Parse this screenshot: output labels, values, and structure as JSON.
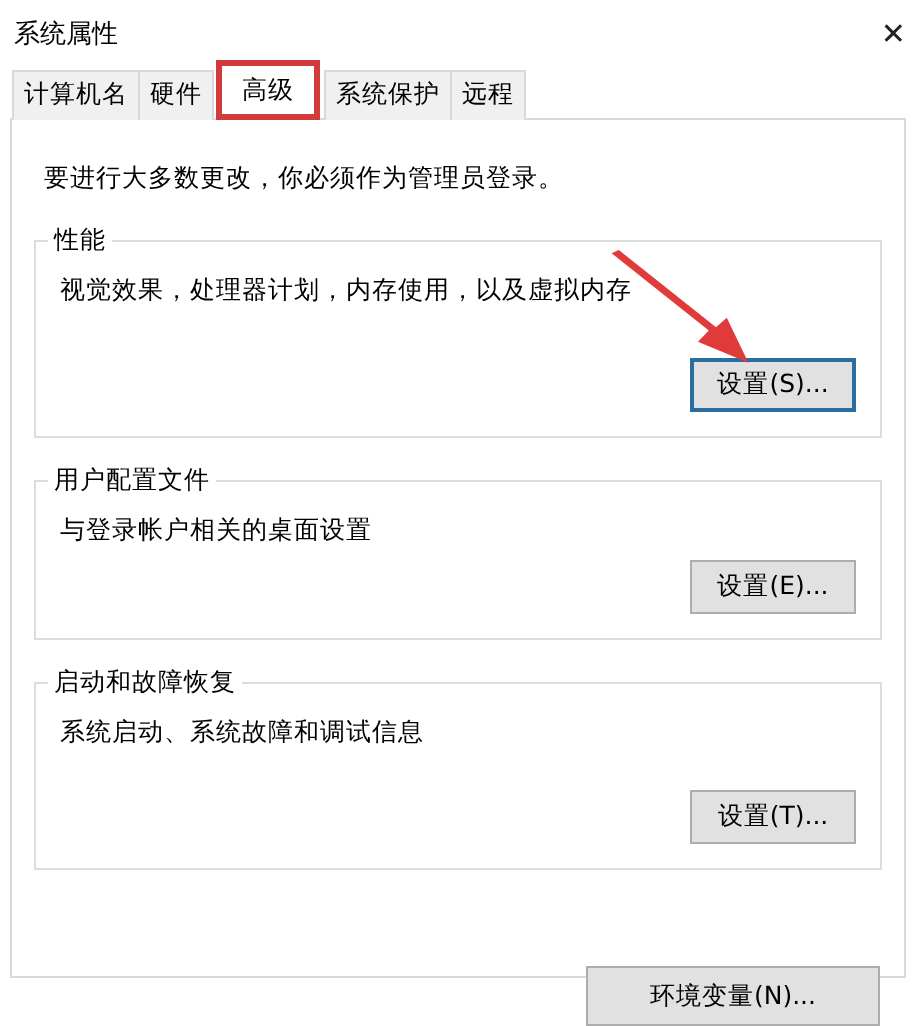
{
  "window": {
    "title": "系统属性",
    "close": "✕"
  },
  "tabs": [
    {
      "label": "计算机名",
      "selected": false,
      "highlighted": false
    },
    {
      "label": "硬件",
      "selected": false,
      "highlighted": false
    },
    {
      "label": "高级",
      "selected": true,
      "highlighted": true
    },
    {
      "label": "系统保护",
      "selected": false,
      "highlighted": false
    },
    {
      "label": "远程",
      "selected": false,
      "highlighted": false
    }
  ],
  "notice": "要进行大多数更改，你必须作为管理员登录。",
  "groups": [
    {
      "title": "性能",
      "description": "视觉效果，处理器计划，内存使用，以及虚拟内存",
      "button": "设置(S)...",
      "focused": true,
      "arrowed": true
    },
    {
      "title": "用户配置文件",
      "description": "与登录帐户相关的桌面设置",
      "button": "设置(E)...",
      "focused": false,
      "arrowed": false
    },
    {
      "title": "启动和故障恢复",
      "description": "系统启动、系统故障和调试信息",
      "button": "设置(T)...",
      "focused": false,
      "arrowed": false
    }
  ],
  "bottom_button": "环境变量(N)..."
}
